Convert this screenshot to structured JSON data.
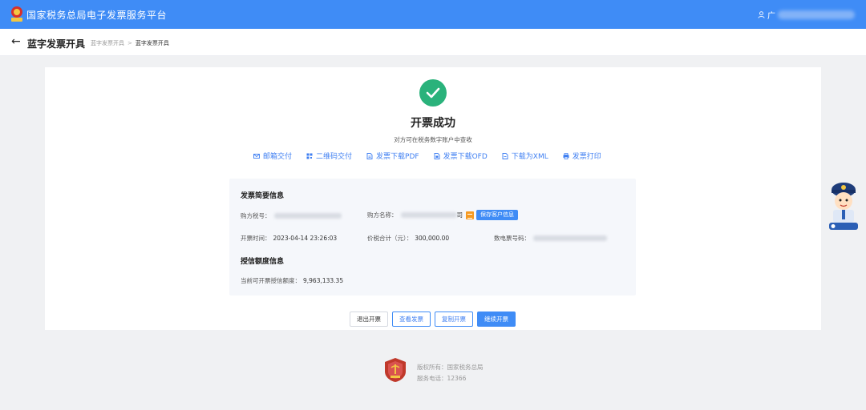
{
  "header": {
    "app_title": "国家税务总局电子发票服务平台",
    "user_prefix": "广"
  },
  "subheader": {
    "page_title": "蓝字发票开具",
    "breadcrumb": [
      "蓝字发票开具",
      "蓝字发票开具"
    ]
  },
  "result": {
    "title": "开票成功",
    "subtitle": "对方可在税务数字账户中查收"
  },
  "actions": [
    {
      "label": "邮箱交付",
      "icon": "mail-icon"
    },
    {
      "label": "二维码交付",
      "icon": "qrcode-icon"
    },
    {
      "label": "发票下载PDF",
      "icon": "pdf-download-icon"
    },
    {
      "label": "发票下载OFD",
      "icon": "ofd-download-icon"
    },
    {
      "label": "下载为XML",
      "icon": "xml-download-icon"
    },
    {
      "label": "发票打印",
      "icon": "printer-icon"
    }
  ],
  "summary": {
    "section_title": "发票简要信息",
    "buyer_tax_no_label": "购方税号：",
    "buyer_name_label": "购方名称：",
    "buyer_name_suffix": "司",
    "save_customer_label": "保存客户信息",
    "issue_time_label": "开票时间：",
    "issue_time": "2023-04-14 23:26:03",
    "total_label": "价税合计（元）：",
    "total": "300,000.00",
    "invoice_no_label": "数电票号码："
  },
  "credit": {
    "section_title": "授信额度信息",
    "available_label": "当前可开票授信额度：",
    "available": "9,963,133.35"
  },
  "buttons": {
    "exit": "退出开票",
    "view": "查看发票",
    "copy": "复制开票",
    "continue": "继续开票"
  },
  "footer": {
    "copyright": "版权所有：国家税务总局",
    "phone": "服务电话：12366"
  },
  "colors": {
    "brand_blue": "#3f8cf6",
    "success_green": "#2ab27b",
    "warning_orange": "#f59a23"
  }
}
